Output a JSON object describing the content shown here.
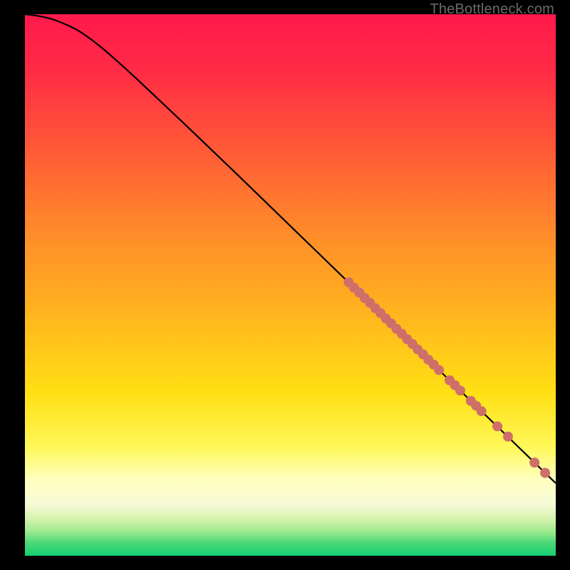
{
  "watermark": "TheBottleneck.com",
  "chart_data": {
    "type": "line",
    "title": "",
    "xlabel": "",
    "ylabel": "",
    "xlim": [
      0,
      100
    ],
    "ylim": [
      0,
      100
    ],
    "gradient_stops": [
      {
        "offset": 0.0,
        "color": "#ff1a4b"
      },
      {
        "offset": 0.1,
        "color": "#ff2a46"
      },
      {
        "offset": 0.25,
        "color": "#ff5a36"
      },
      {
        "offset": 0.4,
        "color": "#ff8a2a"
      },
      {
        "offset": 0.55,
        "color": "#ffb41f"
      },
      {
        "offset": 0.7,
        "color": "#ffe014"
      },
      {
        "offset": 0.8,
        "color": "#fff85a"
      },
      {
        "offset": 0.86,
        "color": "#ffffc0"
      },
      {
        "offset": 0.905,
        "color": "#f6fbd8"
      },
      {
        "offset": 0.93,
        "color": "#d9f3b0"
      },
      {
        "offset": 0.955,
        "color": "#9ee98d"
      },
      {
        "offset": 0.975,
        "color": "#4fd97a"
      },
      {
        "offset": 1.0,
        "color": "#14cf72"
      }
    ],
    "curve": [
      {
        "x": 0,
        "y": 100.0
      },
      {
        "x": 3,
        "y": 99.6
      },
      {
        "x": 6,
        "y": 98.8
      },
      {
        "x": 10,
        "y": 97.0
      },
      {
        "x": 14,
        "y": 94.2
      },
      {
        "x": 18,
        "y": 90.8
      },
      {
        "x": 22,
        "y": 87.2
      },
      {
        "x": 30,
        "y": 79.8
      },
      {
        "x": 40,
        "y": 70.4
      },
      {
        "x": 50,
        "y": 60.9
      },
      {
        "x": 60,
        "y": 51.4
      },
      {
        "x": 70,
        "y": 41.9
      },
      {
        "x": 80,
        "y": 32.4
      },
      {
        "x": 90,
        "y": 22.9
      },
      {
        "x": 100,
        "y": 13.4
      }
    ],
    "markers": [
      {
        "x": 61,
        "y": 50.5
      },
      {
        "x": 62,
        "y": 49.5
      },
      {
        "x": 63,
        "y": 48.6
      },
      {
        "x": 64,
        "y": 47.6
      },
      {
        "x": 65,
        "y": 46.7
      },
      {
        "x": 66,
        "y": 45.7
      },
      {
        "x": 67,
        "y": 44.8
      },
      {
        "x": 68,
        "y": 43.8
      },
      {
        "x": 69,
        "y": 42.9
      },
      {
        "x": 70,
        "y": 41.9
      },
      {
        "x": 71,
        "y": 41.0
      },
      {
        "x": 72,
        "y": 40.0
      },
      {
        "x": 73,
        "y": 39.1
      },
      {
        "x": 74,
        "y": 38.1
      },
      {
        "x": 75,
        "y": 37.2
      },
      {
        "x": 76,
        "y": 36.2
      },
      {
        "x": 77,
        "y": 35.3
      },
      {
        "x": 78,
        "y": 34.3
      },
      {
        "x": 80,
        "y": 32.4
      },
      {
        "x": 81,
        "y": 31.5
      },
      {
        "x": 82,
        "y": 30.5
      },
      {
        "x": 84,
        "y": 28.6
      },
      {
        "x": 85,
        "y": 27.7
      },
      {
        "x": 86,
        "y": 26.7
      },
      {
        "x": 89,
        "y": 23.9
      },
      {
        "x": 91,
        "y": 22.0
      },
      {
        "x": 96,
        "y": 17.2
      },
      {
        "x": 98,
        "y": 15.3
      }
    ],
    "marker_color": "#cf6f6a",
    "curve_color": "#000000"
  }
}
